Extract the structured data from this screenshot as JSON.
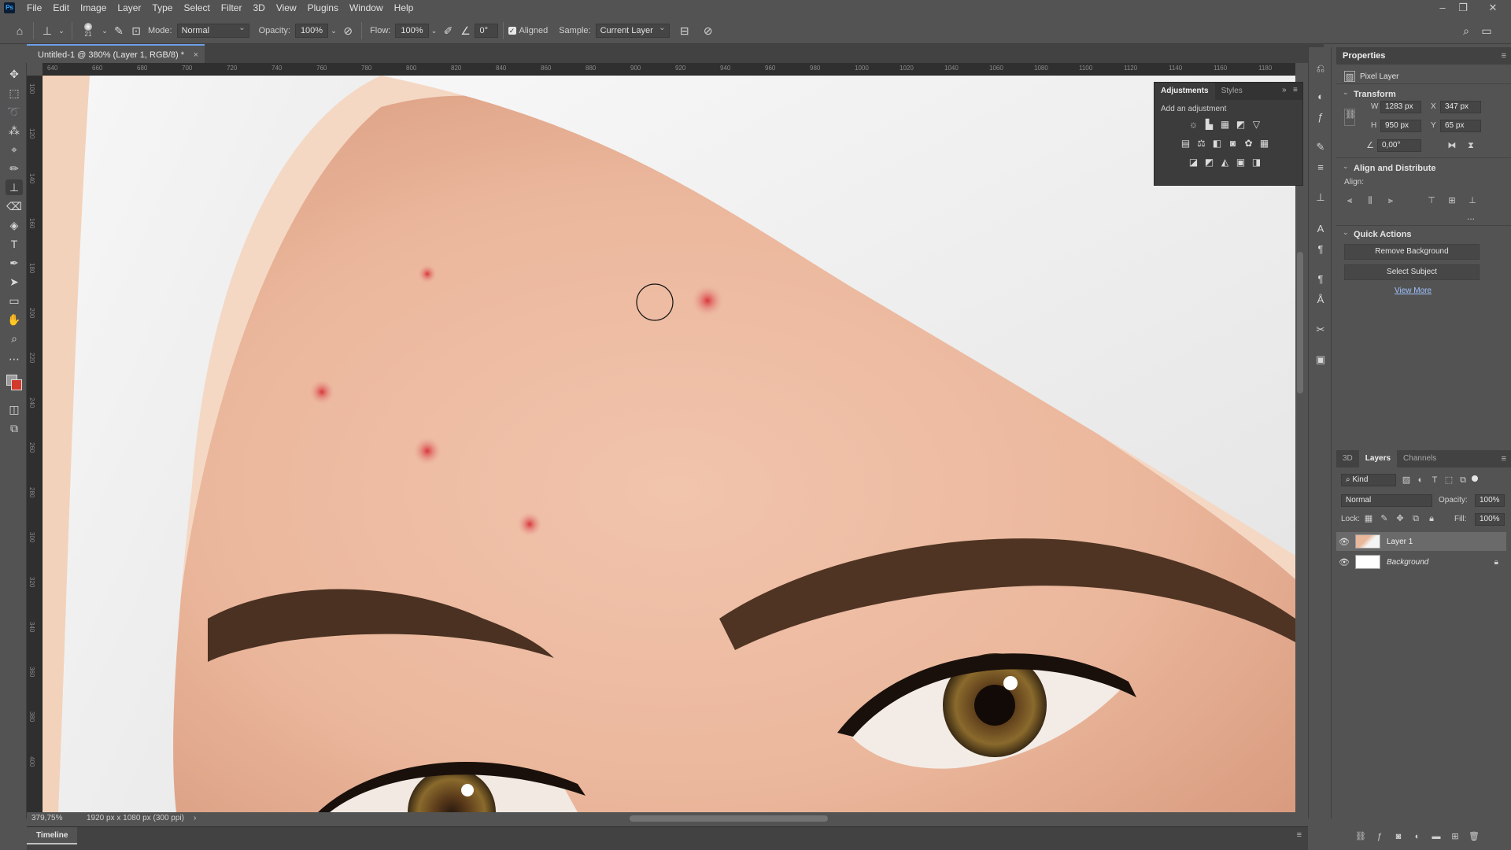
{
  "app": {
    "logo": "Ps"
  },
  "menu": [
    "File",
    "Edit",
    "Image",
    "Layer",
    "Type",
    "Select",
    "Filter",
    "3D",
    "View",
    "Plugins",
    "Window",
    "Help"
  ],
  "window_controls": {
    "minimize": "–",
    "restore": "❐",
    "close": "✕"
  },
  "options_bar": {
    "brush_size": "21",
    "mode_label": "Mode:",
    "mode_value": "Normal",
    "opacity_label": "Opacity:",
    "opacity_value": "100%",
    "flow_label": "Flow:",
    "flow_value": "100%",
    "angle_value": "0°",
    "aligned_label": "Aligned",
    "sample_label": "Sample:",
    "sample_value": "Current Layer"
  },
  "document": {
    "tab_title": "Untitled-1 @ 380% (Layer 1, RGB/8) *",
    "close": "×"
  },
  "ruler_top": [
    "640",
    "660",
    "680",
    "700",
    "720",
    "740",
    "760",
    "780",
    "800",
    "820",
    "840",
    "860",
    "880",
    "900",
    "920",
    "940",
    "960",
    "980",
    "1000",
    "1020",
    "1040",
    "1060",
    "1080",
    "1100",
    "1120",
    "1140",
    "1160",
    "1180"
  ],
  "ruler_left": [
    "100",
    "120",
    "140",
    "160",
    "180",
    "200",
    "220",
    "240",
    "260",
    "280",
    "300",
    "320",
    "340",
    "360",
    "380",
    "400"
  ],
  "adjustments": {
    "tab_adjustments": "Adjustments",
    "tab_styles": "Styles",
    "add_label": "Add an adjustment",
    "menu": "≡",
    "collapse": "»"
  },
  "properties": {
    "title": "Properties",
    "layer_type": "Pixel Layer",
    "transform_title": "Transform",
    "w_label": "W",
    "w_value": "1283 px",
    "h_label": "H",
    "h_value": "950 px",
    "x_label": "X",
    "x_value": "347 px",
    "y_label": "Y",
    "y_value": "65 px",
    "angle_value": "0,00°",
    "align_title": "Align and Distribute",
    "align_label": "Align:",
    "more": "...",
    "quick_actions_title": "Quick Actions",
    "remove_background": "Remove Background",
    "select_subject": "Select Subject",
    "view_more": "View More"
  },
  "layers_panel": {
    "tab_3d": "3D",
    "tab_layers": "Layers",
    "tab_channels": "Channels",
    "filter_kind": "Kind",
    "blend_mode": "Normal",
    "opacity_label": "Opacity:",
    "opacity_value": "100%",
    "lock_label": "Lock:",
    "fill_label": "Fill:",
    "fill_value": "100%",
    "layers": [
      {
        "name": "Layer 1",
        "visible": true,
        "selected": true
      },
      {
        "name": "Background",
        "visible": true,
        "locked": true
      }
    ]
  },
  "status": {
    "zoom": "379,75%",
    "doc_info": "1920 px x 1080 px (300 ppi)",
    "arrow": "›"
  },
  "timeline": {
    "tab": "Timeline"
  },
  "colors": {
    "accent": "#6d9ee8",
    "panel_bg": "#535353",
    "panel_dark": "#424242",
    "foreground_swatch": "#9a9a9a",
    "background_swatch": "#d23a2e"
  }
}
